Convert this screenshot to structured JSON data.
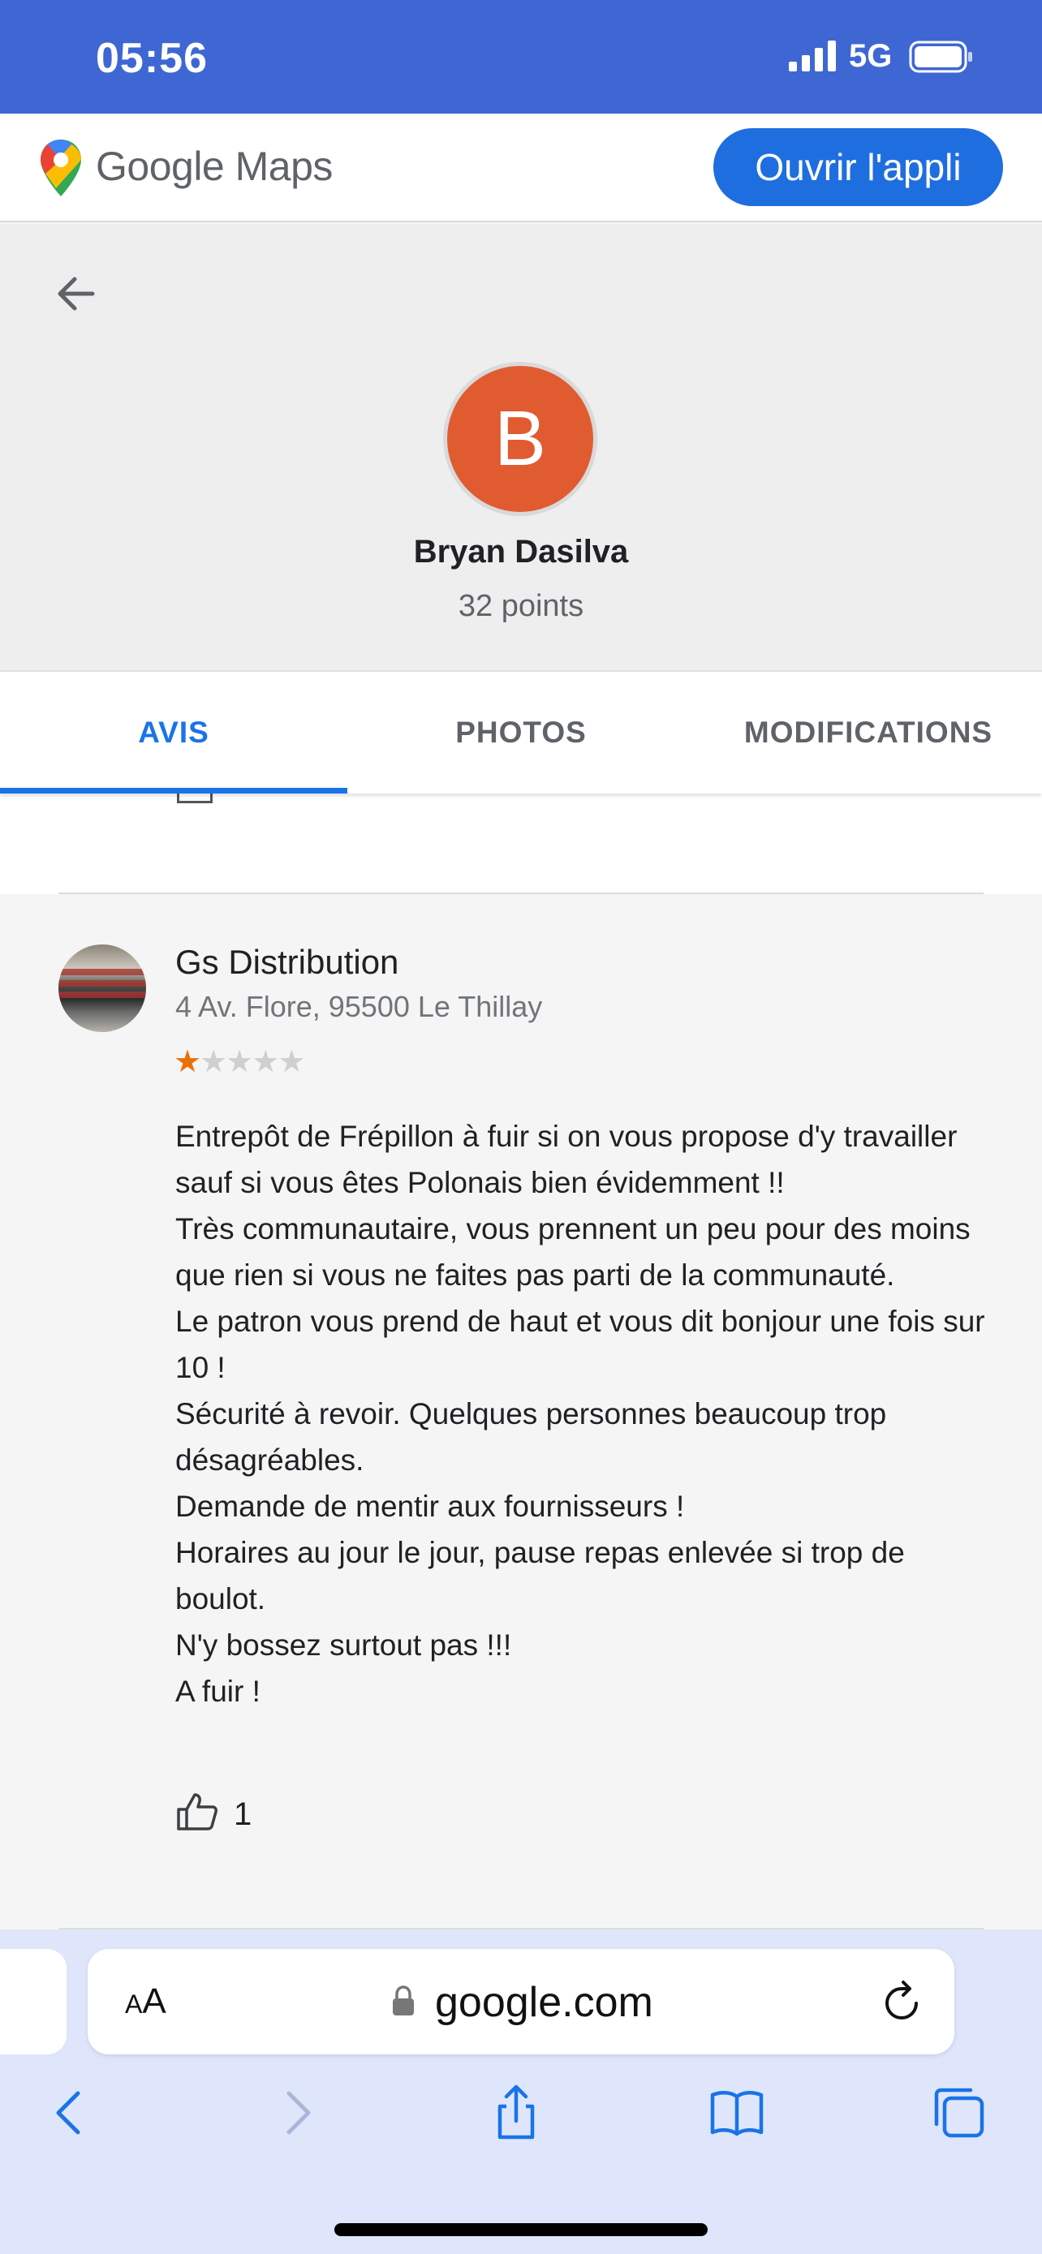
{
  "status_bar": {
    "time": "05:56",
    "network": "5G"
  },
  "header": {
    "logo_text": "Google Maps",
    "open_app_label": "Ouvrir l'appli"
  },
  "profile": {
    "avatar_letter": "B",
    "name": "Bryan Dasilva",
    "points": "32 points"
  },
  "tabs": [
    {
      "label": "AVIS",
      "active": true
    },
    {
      "label": "PHOTOS",
      "active": false
    },
    {
      "label": "MODIFICATIONS",
      "active": false
    }
  ],
  "review": {
    "place_name": "Gs Distribution",
    "address": "4 Av. Flore, 95500 Le Thillay",
    "rating": 1,
    "rating_max": 5,
    "text": "Entrepôt de Frépillon à fuir si on vous propose d'y travailler sauf si vous êtes Polonais bien évidemment !!\nTrès communautaire, vous prennent un peu pour des moins que rien si vous ne faites pas parti de la communauté.\nLe patron vous prend de haut et vous dit bonjour une fois sur 10 !\nSécurité à revoir. Quelques personnes beaucoup trop désagréables.\nDemande de mentir aux fournisseurs !\nHoraires au jour le jour, pause repas enlevée si trop de boulot.\nN'y bossez surtout pas !!!\nA fuir !",
    "likes": "1"
  },
  "browser": {
    "text_size_label_small": "A",
    "text_size_label_large": "A",
    "url": "google.com"
  },
  "colors": {
    "status_bar": "#3f67d3",
    "primary_button": "#1f6ee0",
    "active_tab": "#1a73e8",
    "avatar_bg": "#e15b31",
    "star_on": "#e8710a",
    "safari_bg": "#dfe6fb"
  },
  "icons": {
    "back": "arrow-left-icon",
    "like": "thumb-up-icon",
    "lock": "lock-icon",
    "reload": "reload-icon",
    "nav_back": "chevron-left-icon",
    "nav_forward": "chevron-right-icon",
    "share": "share-icon",
    "bookmarks": "book-icon",
    "tabs": "tabs-icon"
  }
}
